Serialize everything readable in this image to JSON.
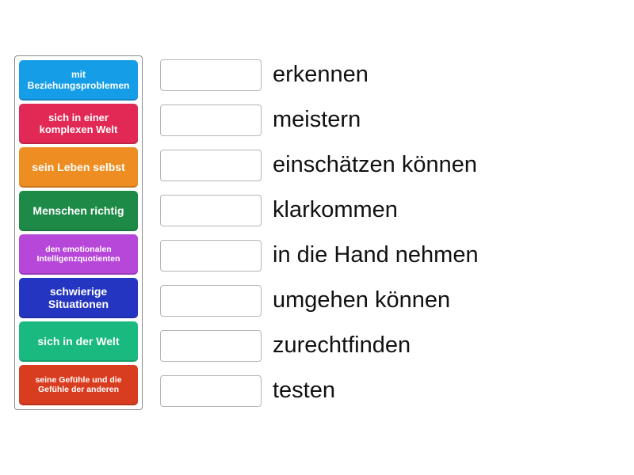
{
  "tiles": [
    {
      "label": "mit Beziehungsproblemen",
      "color": "#159ee7",
      "font_size": "12px"
    },
    {
      "label": "sich in einer komplexen Welt",
      "color": "#e22955",
      "font_size": "13px"
    },
    {
      "label": "sein Leben selbst",
      "color": "#ee8d21",
      "font_size": "14px"
    },
    {
      "label": "Menschen richtig",
      "color": "#1d8a47",
      "font_size": "14px"
    },
    {
      "label": "den emotionalen Intelligenzquotienten",
      "color": "#b747d9",
      "font_size": "10.5px"
    },
    {
      "label": "schwierige Situationen",
      "color": "#2436c1",
      "font_size": "14px"
    },
    {
      "label": "sich in der Welt",
      "color": "#19b980",
      "font_size": "14px"
    },
    {
      "label": "seine Gefühle und die Gefühle der anderen",
      "color": "#d93d20",
      "font_size": "10.5px"
    }
  ],
  "answers": [
    {
      "text": "erkennen"
    },
    {
      "text": "meistern"
    },
    {
      "text": "einschätzen können"
    },
    {
      "text": "klarkommen"
    },
    {
      "text": "in die Hand nehmen"
    },
    {
      "text": "umgehen können"
    },
    {
      "text": "zurechtfinden"
    },
    {
      "text": "testen"
    }
  ]
}
